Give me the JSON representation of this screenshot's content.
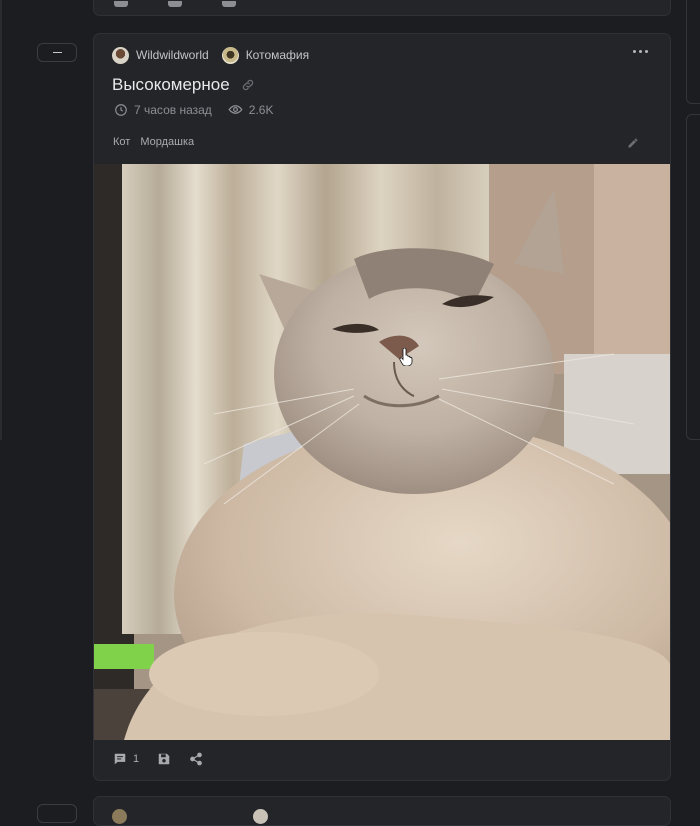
{
  "post": {
    "author": "Wildwildworld",
    "community": "Котомафия",
    "title": "Высокомерное",
    "time": "7 часов назад",
    "views": "2.6K",
    "tags": [
      "Кот",
      "Мордашка"
    ],
    "comments_count": "1",
    "image_alt": "Кот"
  },
  "icons": {
    "collapse": "minus-icon",
    "more": "more-horizontal-icon",
    "link": "link-icon",
    "time": "clock-icon",
    "views": "eye-icon",
    "edit": "pencil-icon",
    "comments": "comment-icon",
    "save": "floppy-disk-icon",
    "share": "share-icon",
    "cursor": "hand-pointer-icon"
  },
  "colors": {
    "background": "#1c1d20",
    "card": "#242529",
    "border": "#303136",
    "text_primary": "#e9e9ea",
    "text_secondary": "#8e8f94"
  }
}
